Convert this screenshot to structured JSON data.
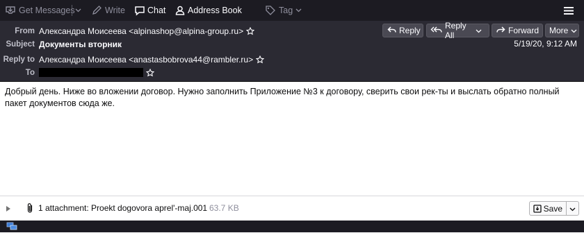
{
  "toolbar": {
    "get_messages": "Get Messages",
    "write": "Write",
    "chat": "Chat",
    "address_book": "Address Book",
    "tag": "Tag"
  },
  "header": {
    "from_label": "From",
    "from_value": "Александра Моисеева <alpinashop@alpina-group.ru>",
    "subject_label": "Subject",
    "subject_value": "Документы вторник",
    "reply_to_label": "Reply to",
    "reply_to_value": "Александра Моисеева <anastasbobrova44@rambler.ru>",
    "to_label": "To",
    "date": "5/19/20, 9:12 AM",
    "buttons": {
      "reply": "Reply",
      "reply_all": "Reply All",
      "forward": "Forward",
      "more": "More"
    }
  },
  "message": {
    "body": "Добрый день. Ниже во вложении договор. Нужно заполнить Приложение №3 к договору, сверить свои рек-ты и выслать обратно полный пакет документов сюда же."
  },
  "attachment": {
    "summary": "1 attachment: Proekt dogovora aprel'-maj.001",
    "size": "63.7 KB",
    "save_label": "Save"
  },
  "colors": {
    "toolbar_bg": "#1c1b22",
    "header_bg": "#2b2a33",
    "button_bg": "#4a4953",
    "text_light": "#fbfbfe",
    "text_dim": "#8f8f9d"
  }
}
